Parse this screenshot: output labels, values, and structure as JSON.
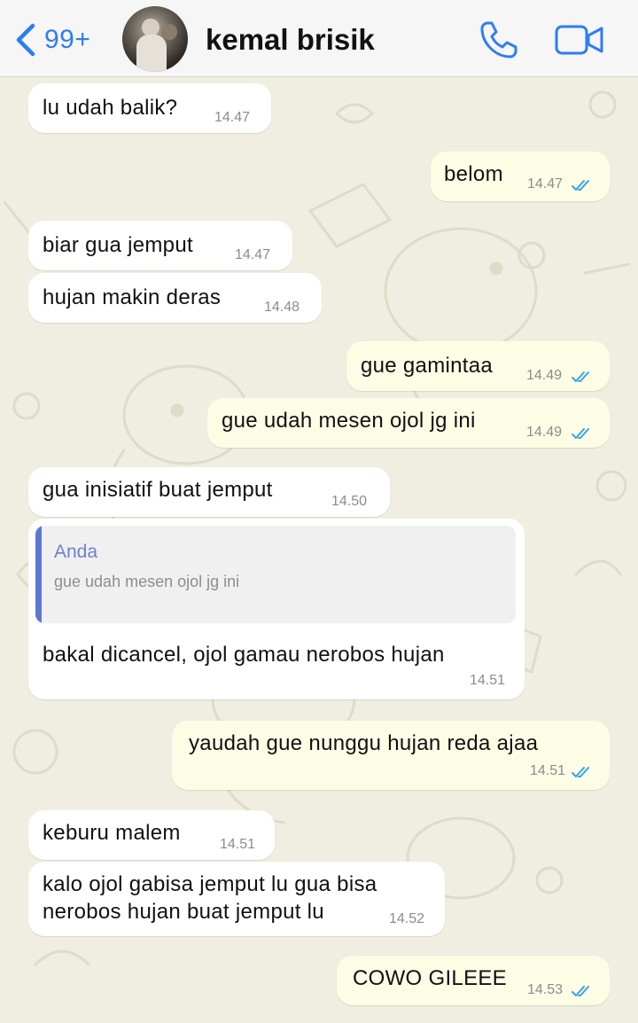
{
  "header": {
    "back_count": "99+",
    "contact_name": "kemal brisik"
  },
  "colors": {
    "accent": "#2e7cf6",
    "incoming_bubble": "#ffffff",
    "outgoing_bubble": "#fdfde6",
    "read_ticks": "#34a4e8",
    "reply_bar": "#5b78d6"
  },
  "messages": [
    {
      "direction": "in",
      "text": "lu udah balik?",
      "time": "14.47"
    },
    {
      "direction": "out",
      "text": "belom",
      "time": "14.47",
      "status": "read"
    },
    {
      "direction": "in",
      "text": "biar gua jemput",
      "time": "14.47"
    },
    {
      "direction": "in",
      "text": "hujan makin deras",
      "time": "14.48"
    },
    {
      "direction": "out",
      "text": "gue gamintaa",
      "time": "14.49",
      "status": "read"
    },
    {
      "direction": "out",
      "text": "gue udah mesen ojol jg ini",
      "time": "14.49",
      "status": "read"
    },
    {
      "direction": "in",
      "text": "gua inisiatif buat jemput",
      "time": "14.50"
    },
    {
      "direction": "in",
      "text": "bakal dicancel, ojol gamau nerobos hujan",
      "time": "14.51",
      "reply": {
        "author": "Anda",
        "text": "gue udah mesen ojol jg ini"
      }
    },
    {
      "direction": "out",
      "text": "yaudah gue nunggu hujan reda ajaa",
      "time": "14.51",
      "status": "read"
    },
    {
      "direction": "in",
      "text": "keburu malem",
      "time": "14.51"
    },
    {
      "direction": "in",
      "text_lines": [
        "kalo ojol gabisa jemput lu gua bisa",
        "nerobos hujan buat jemput lu"
      ],
      "time": "14.52"
    },
    {
      "direction": "out",
      "text": "COWO GILEEE",
      "time": "14.53",
      "status": "read"
    }
  ]
}
